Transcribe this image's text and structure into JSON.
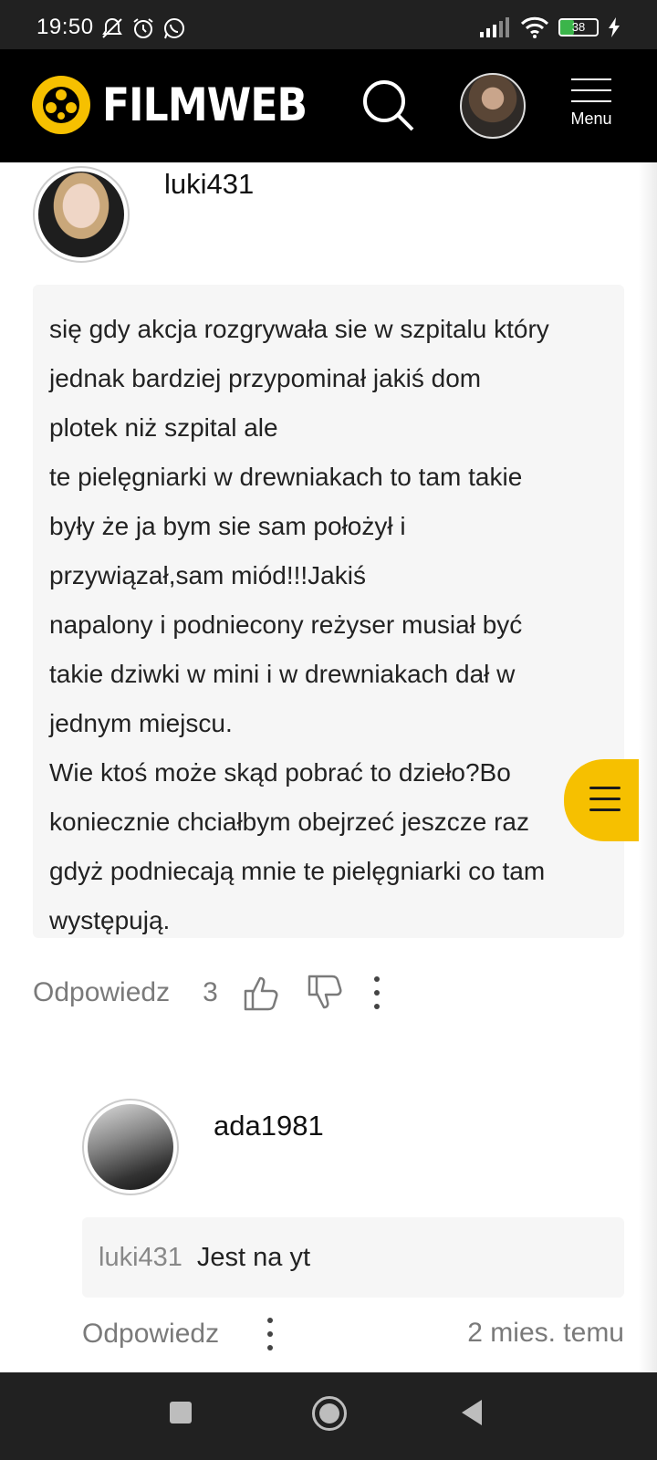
{
  "status_bar": {
    "time": "19:50",
    "battery_level": "38",
    "icons_left": [
      "bell-off-icon",
      "alarm-icon",
      "whatsapp-icon"
    ],
    "icons_right": [
      "signal-icon",
      "wifi-icon",
      "battery-icon",
      "charging-icon"
    ]
  },
  "header": {
    "logo_text": "FILMWEB",
    "menu_label": "Menu",
    "brand_color": "#f6c000"
  },
  "comment": {
    "username": "luki431",
    "text": " się gdy akcja rozgrywała sie w szpitalu który\njednak bardziej przypominał jakiś dom\nplotek niż szpital ale\nte pielęgniarki w drewniakach to tam takie\nbyły że ja bym sie sam położył i\nprzywiązał,sam miód!!!Jakiś\nnapalony i podniecony reżyser musiał być\ntakie dziwki w mini i w drewniakach dał w\njednym miejscu.\nWie ktoś może skąd pobrać to dzieło?Bo\nkoniecznie chciałbym obejrzeć jeszcze raz\ngdyż podniecają mnie te pielęgniarki co tam\nwystępują.",
    "reply_label": "Odpowiedz",
    "likes": "3"
  },
  "reply": {
    "username": "ada1981",
    "mention": "luki431",
    "text": "Jest na yt",
    "reply_label": "Odpowiedz",
    "timestamp": "2 mies. temu"
  }
}
